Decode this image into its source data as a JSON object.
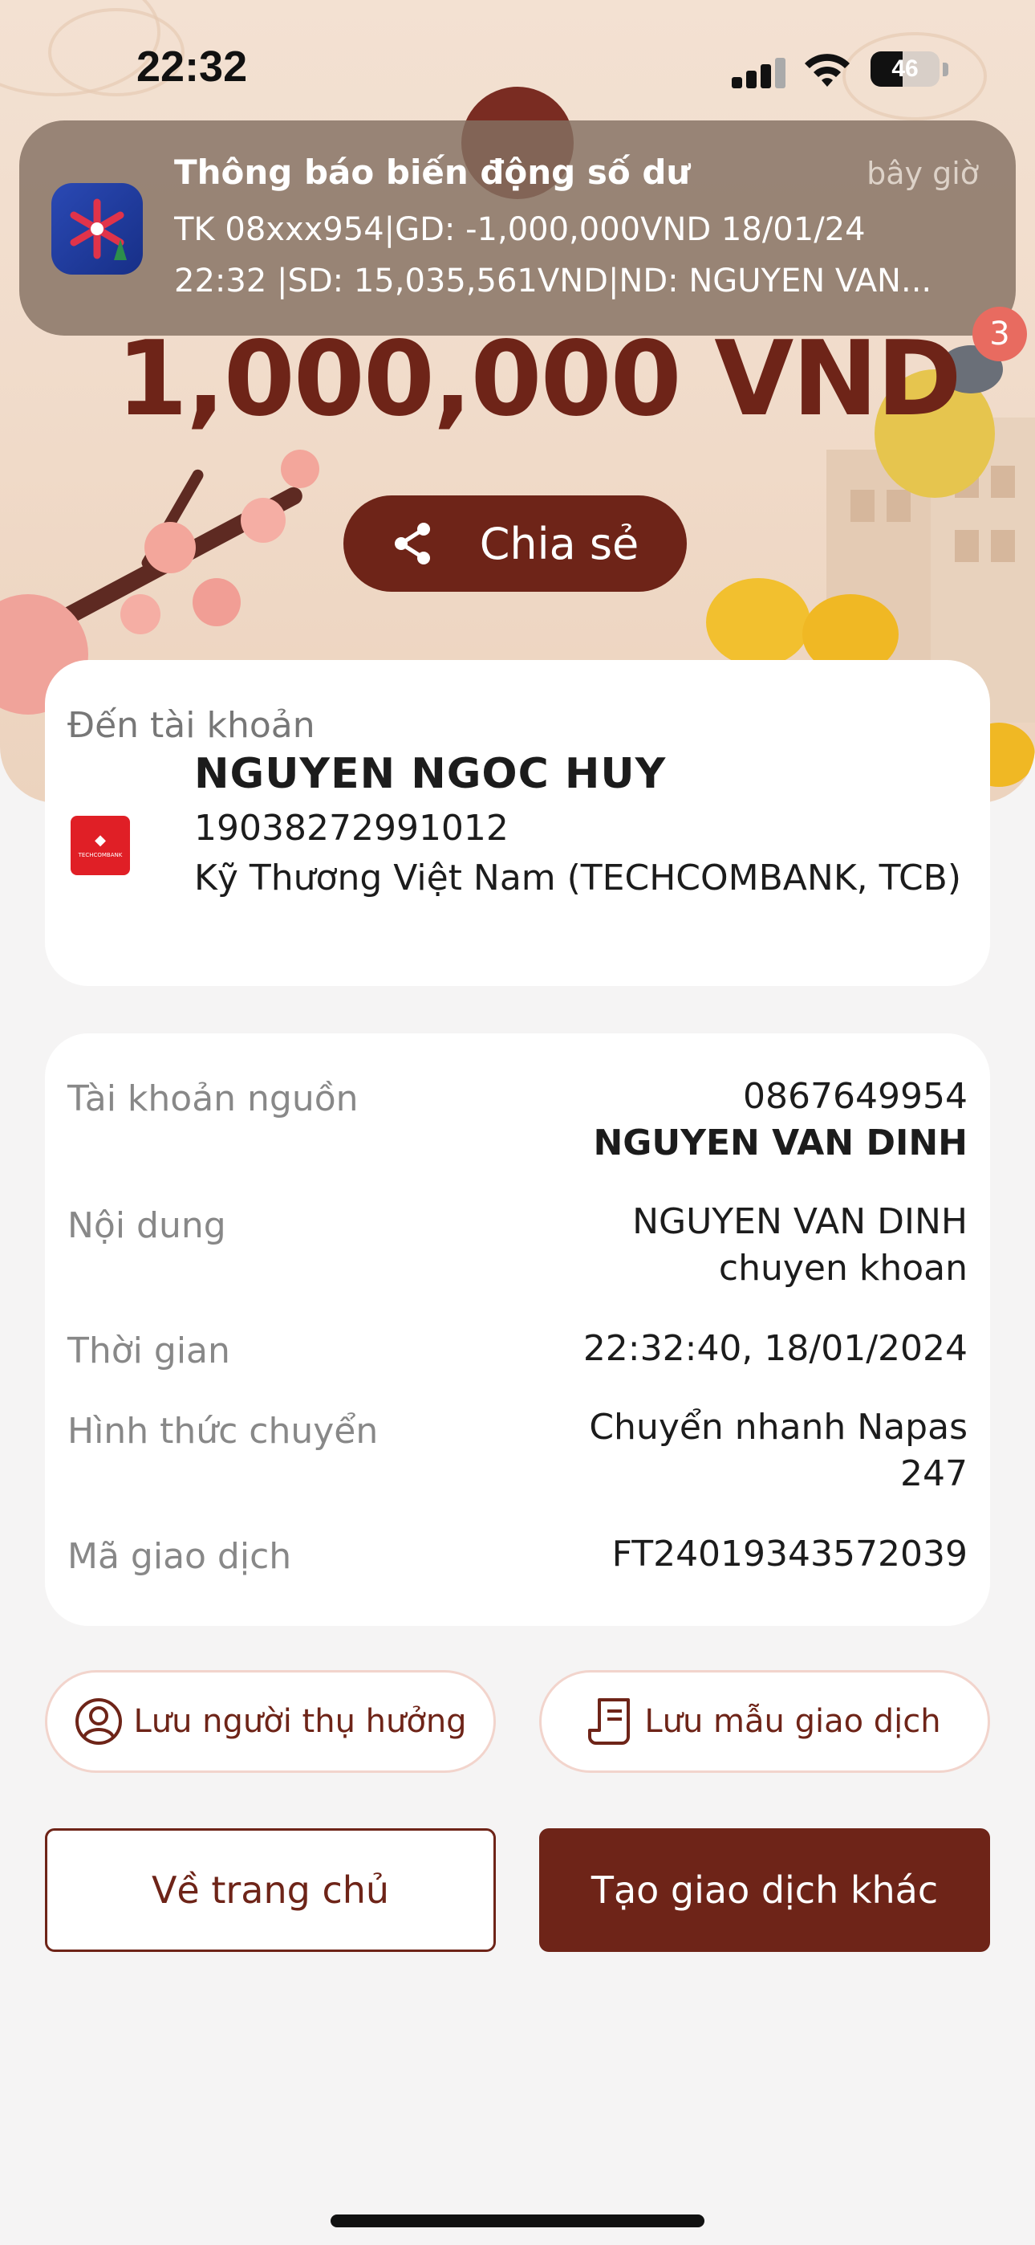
{
  "status_bar": {
    "time": "22:32",
    "battery": "46",
    "battery_level": 0.46
  },
  "notification": {
    "title": "Thông báo biến động số dư",
    "time": "bây giờ",
    "line1": "TK 08xxx954|GD: -1,000,000VND 18/01/24",
    "line2": "22:32 |SD: 15,035,561VND|ND: NGUYEN VAN..."
  },
  "badge_count": "3",
  "amount": "1,000,000 VND",
  "share_label": "Chia sẻ",
  "destination": {
    "label": "Đến tài khoản",
    "name": "NGUYEN NGOC HUY",
    "account": "19038272991012",
    "bank": "Kỹ Thương Việt Nam (TECHCOMBANK, TCB)",
    "bank_logo_text": "TECHCOMBANK"
  },
  "details": {
    "source_label": "Tài khoản nguồn",
    "source_account": "0867649954",
    "source_name": "NGUYEN VAN DINH",
    "content_label": "Nội dung",
    "content_line1": "NGUYEN VAN DINH",
    "content_line2": "chuyen khoan",
    "time_label": "Thời gian",
    "time_value": "22:32:40, 18/01/2024",
    "method_label": "Hình thức chuyển",
    "method_line1": "Chuyển nhanh Napas",
    "method_line2": "247",
    "txn_label": "Mã giao dịch",
    "txn_value": "FT24019343572039"
  },
  "actions": {
    "save_beneficiary": "Lưu người thụ hưởng",
    "save_template": "Lưu mẫu giao dịch",
    "home": "Về trang chủ",
    "new_transaction": "Tạo giao dịch khác"
  },
  "colors": {
    "primary": "#6e2418",
    "background": "#f5f4f4"
  }
}
